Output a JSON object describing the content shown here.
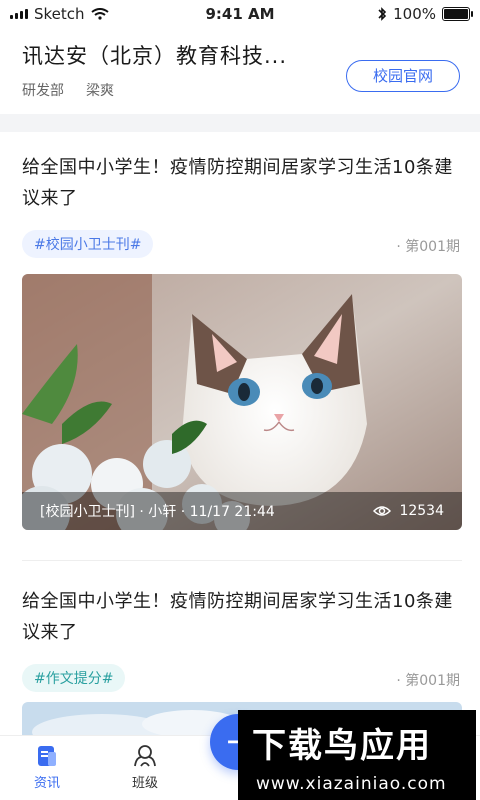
{
  "status_bar": {
    "carrier": "Sketch",
    "time": "9:41 AM",
    "battery": "100%"
  },
  "header": {
    "org_name": "讯达安（北京）教育科技...",
    "department": "研发部",
    "user": "梁爽",
    "site_button": "校园官网"
  },
  "feed": [
    {
      "title": "给全国中小学生！疫情防控期间居家学习生活10条建议来了",
      "tag": "#校园小卫士刊#",
      "issue": "· 第001期",
      "caption": "[校园小卫士刊] · 小轩 · 11/17 21:44",
      "views": "12534",
      "tag_color": "#4b79e6"
    },
    {
      "title": "给全国中小学生！疫情防控期间居家学习生活10条建议来了",
      "tag": "#作文提分#",
      "issue": "· 第001期",
      "tag_color": "#2aa0a0"
    }
  ],
  "bottom_nav": [
    {
      "label": "资讯",
      "icon": "news-icon",
      "active": true
    },
    {
      "label": "班级",
      "icon": "class-icon",
      "active": false
    }
  ],
  "fab": {
    "icon": "plus-icon"
  },
  "watermark": {
    "logo_text": "下载鸟应用",
    "url": "www.xiazainiao.com"
  }
}
